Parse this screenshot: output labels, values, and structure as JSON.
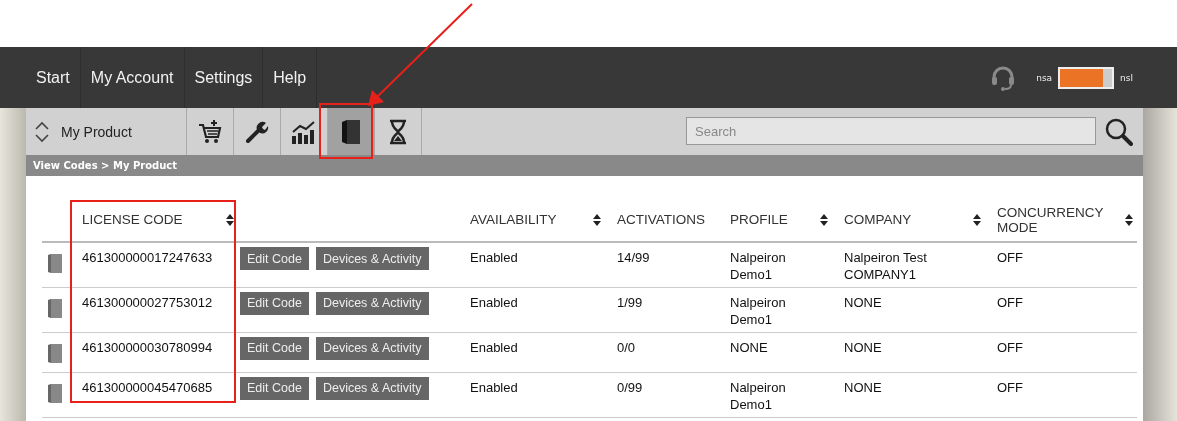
{
  "nav": {
    "items": [
      "Start",
      "My Account",
      "Settings",
      "Help"
    ],
    "toggle": {
      "left_label": "nsa",
      "right_label": "nsl",
      "on": true
    }
  },
  "toolbar": {
    "product": "My Product",
    "tools": [
      {
        "kind": "cart",
        "selected": false
      },
      {
        "kind": "wrench",
        "selected": false
      },
      {
        "kind": "chart",
        "selected": false
      },
      {
        "kind": "book",
        "selected": true
      },
      {
        "kind": "hourglass",
        "selected": false
      }
    ],
    "search": {
      "placeholder": "Search"
    }
  },
  "breadcrumb": "View Codes > My Product",
  "table": {
    "columns": [
      {
        "label": "LICENSE CODE",
        "sortable": true
      },
      {
        "label": "AVAILABILITY",
        "sortable": true
      },
      {
        "label": "ACTIVATIONS",
        "sortable": false
      },
      {
        "label": "PROFILE",
        "sortable": true
      },
      {
        "label": "COMPANY",
        "sortable": true
      },
      {
        "label": "CONCURRENCY MODE",
        "sortable": true
      }
    ],
    "rows": [
      {
        "code": "461300000017247633",
        "buttons": [
          "Edit Code",
          "Devices & Activity"
        ],
        "availability": "Enabled",
        "activations": "14/99",
        "profile": "Nalpeiron Demo1",
        "company": "Nalpeiron Test COMPANY1",
        "concurrency": "OFF"
      },
      {
        "code": "461300000027753012",
        "buttons": [
          "Edit Code",
          "Devices & Activity"
        ],
        "availability": "Enabled",
        "activations": "1/99",
        "profile": "Nalpeiron Demo1",
        "company": "NONE",
        "concurrency": "OFF"
      },
      {
        "code": "461300000030780994",
        "buttons": [
          "Edit Code",
          "Devices & Activity"
        ],
        "availability": "Enabled",
        "activations": "0/0",
        "profile": "NONE",
        "company": "NONE",
        "concurrency": "OFF"
      },
      {
        "code": "461300000045470685",
        "buttons": [
          "Edit Code",
          "Devices & Activity"
        ],
        "availability": "Enabled",
        "activations": "0/99",
        "profile": "Nalpeiron Demo1",
        "company": "NONE",
        "concurrency": "OFF"
      }
    ]
  }
}
